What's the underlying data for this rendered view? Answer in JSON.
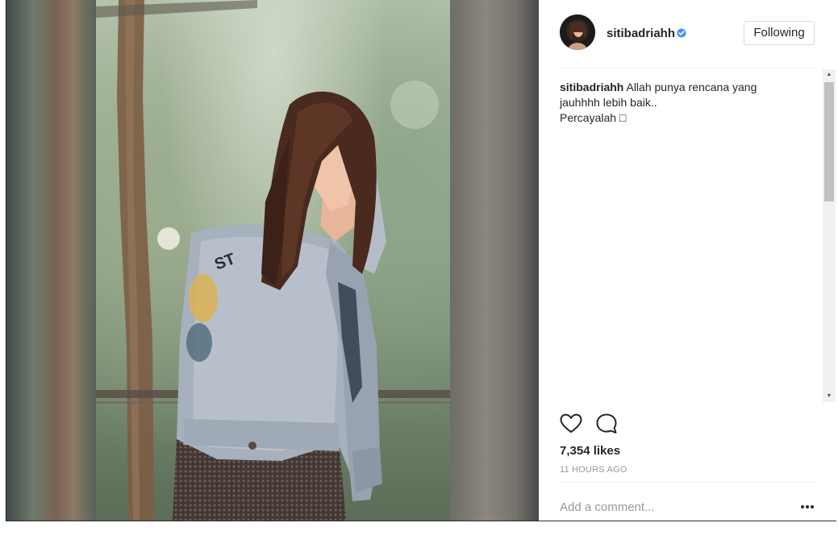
{
  "post": {
    "username": "sitibadriahh",
    "follow_label": "Following",
    "caption": {
      "username": "sitibadriahh",
      "line1": "Allah punya rencana yang",
      "line2": "jauhhhh lebih baik..",
      "line3": "Percayalah □"
    },
    "likes": "7,354 likes",
    "time_ago": "11 HOURS AGO",
    "comment_placeholder": "Add a comment..."
  },
  "icons": {
    "verified": "verified-badge-icon",
    "like": "heart-icon",
    "comment": "speech-bubble-icon",
    "more": "more-options-icon"
  },
  "colors": {
    "verified": "#3897f0",
    "text": "#262626",
    "muted": "#999999",
    "border": "#dbdbdb"
  }
}
